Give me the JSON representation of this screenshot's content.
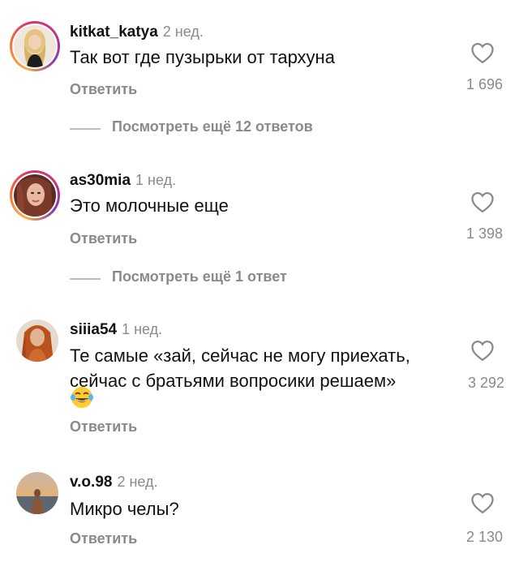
{
  "comments": [
    {
      "username": "kitkat_katya",
      "time": "2 нед.",
      "text_lines": [
        "Так вот где пузырьки от тархуна"
      ],
      "reply_label": "Ответить",
      "likes": "1 696",
      "more_replies": "Посмотреть ещё 12 ответов",
      "story_ring": true
    },
    {
      "username": "as30mia",
      "time": "1 нед.",
      "text_lines": [
        "Это молочные еще"
      ],
      "reply_label": "Ответить",
      "likes": "1 398",
      "more_replies": "Посмотреть ещё 1 ответ",
      "story_ring": true
    },
    {
      "username": "siiia54",
      "time": "1 нед.",
      "text_lines": [
        "Те самые «зай, сейчас не могу приехать,",
        "сейчас с братьями вопросики решаем»"
      ],
      "emoji": "joy-emoji",
      "reply_label": "Ответить",
      "likes": "3 292",
      "story_ring": false
    },
    {
      "username": "v.o.98",
      "time": "2 нед.",
      "text_lines": [
        "Микро челы?"
      ],
      "reply_label": "Ответить",
      "likes": "2 130",
      "story_ring": false
    }
  ],
  "colors": {
    "meta_gray": "#8a8a8a",
    "text": "#111111",
    "divider": "#bdbdbd"
  },
  "icons": {
    "like": "heart-outline-icon"
  }
}
